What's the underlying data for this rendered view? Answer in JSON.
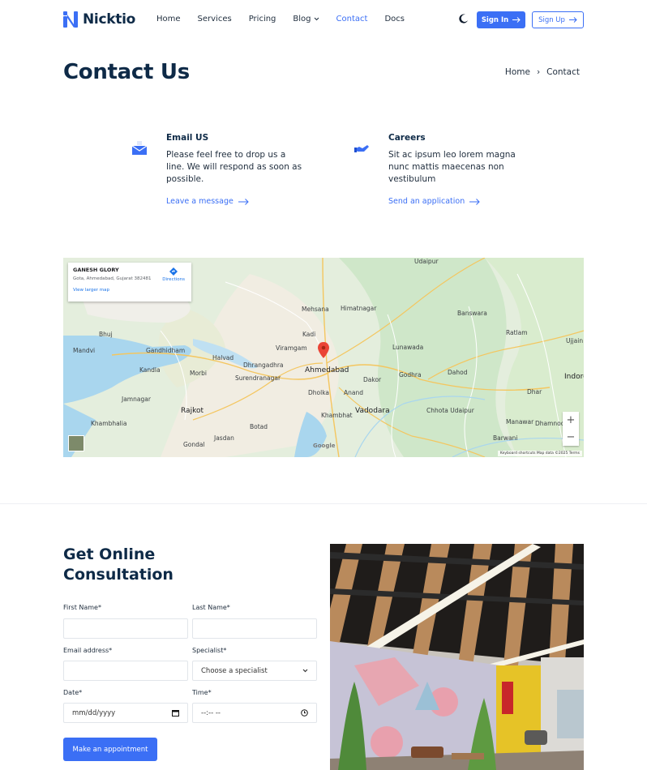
{
  "header": {
    "brand": "Nicktio",
    "nav": [
      {
        "label": "Home",
        "active": false
      },
      {
        "label": "Services",
        "active": false
      },
      {
        "label": "Pricing",
        "active": false
      },
      {
        "label": "Blog",
        "active": false,
        "dropdown": true
      },
      {
        "label": "Contact",
        "active": true
      },
      {
        "label": "Docs",
        "active": false
      }
    ],
    "signin_label": "Sign In",
    "signup_label": "Sign Up",
    "theme_icon": "moon-icon"
  },
  "page": {
    "title": "Contact Us",
    "breadcrumb": {
      "home": "Home",
      "separator": "›",
      "current": "Contact"
    }
  },
  "info": {
    "email": {
      "title": "Email US",
      "text": "Please feel free to drop us a line. We will respond as soon as possible.",
      "link": "Leave a message",
      "icon": "envelope-icon"
    },
    "careers": {
      "title": "Careers",
      "text": "Sit ac ipsum leo lorem magna nunc mattis maecenas non vestibulum",
      "link": "Send an application",
      "icon": "handshake-icon"
    }
  },
  "map": {
    "place": "GANESH GLORY",
    "address": "Gota, Ahmedabad, Gujarat 382481",
    "larger_map": "View larger map",
    "directions": "Directions",
    "footer": "Keyboard shortcuts  Map data ©2025  Terms",
    "google": "Google",
    "cities": [
      "Bhuj",
      "Gandhidham",
      "Jamnagar",
      "Rajkot",
      "Surendranagar",
      "Ahmedabad",
      "Anand",
      "Vadodara",
      "Udaipur",
      "Himatnagar",
      "Mehsana",
      "Godhra",
      "Banswara",
      "Ratlam",
      "Ujjain",
      "Indore",
      "Dahod",
      "Dhar",
      "Kadi",
      "Viramgam",
      "Lunawada",
      "Dhrangadhra",
      "Morbi",
      "Halvad",
      "Mandvi",
      "Kandla",
      "Khambhalia",
      "Botad",
      "Gondal",
      "Jasdan",
      "Dholka",
      "Khambhat",
      "Dakor",
      "Chhota Udaipur",
      "Barwani",
      "Dhamnod",
      "Manawar"
    ],
    "zoom_in": "+",
    "zoom_out": "−"
  },
  "form": {
    "title": "Get Online Consultation",
    "first_name_label": "First Name*",
    "last_name_label": "Last Name*",
    "email_label": "Email address*",
    "specialist_label": "Specialist*",
    "specialist_value": "Choose a specialist",
    "date_label": "Date*",
    "date_placeholder": "mm/dd/yyyy",
    "time_label": "Time*",
    "time_placeholder": "--:-- --",
    "submit": "Make an appointment"
  },
  "colors": {
    "accent": "#3b6ff5",
    "heading": "#0e2a47"
  }
}
